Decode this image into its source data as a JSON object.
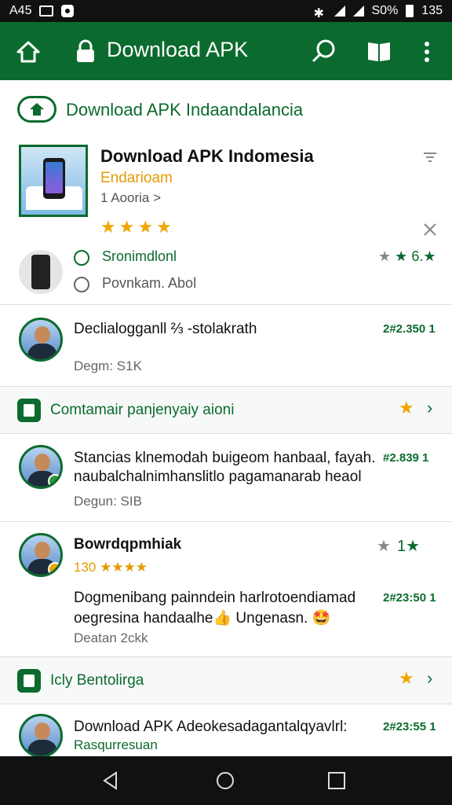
{
  "status_bar": {
    "left_text": "A45",
    "right_text": "S0%",
    "time": "135"
  },
  "app_bar": {
    "title": "Download APK",
    "icons": [
      "home-icon",
      "lock-icon",
      "search-icon",
      "book-icon",
      "more-vert-icon"
    ]
  },
  "header": {
    "title": "Download APK Indaandalancia"
  },
  "app": {
    "name": "Download APK Indomesia",
    "developer": "Endarioam",
    "meta": "1 Aooria >",
    "stars": "★★★★"
  },
  "options": [
    {
      "label": "Sronimdlonl",
      "selected": true
    },
    {
      "label": "Povnkam. Abol",
      "selected": false
    }
  ],
  "option_rating": {
    "value": "6.★",
    "stars_gray": "★",
    "stars_green": "★"
  },
  "rows": [
    {
      "title": "Declialogganll ⅔ -stolakrath",
      "sub": "Degm: S1K",
      "ts": "2#2.350 1"
    },
    {
      "title_line1": "Stancias klnemodah buigeom hanbaal, fayah.",
      "title_line2": "naubalchalnimhanslitlo pagamanarab heaol",
      "sub": "Degun: SIB",
      "ts": "#2.839 1"
    },
    {
      "title": "Bowrdqpmhiak",
      "rating": "130 ★★★★",
      "body_line1": "Dogmenibang painndein harlrotoendiamad",
      "body_line2": "oegresina handaalhe👍 Ungenasn. 🤩",
      "sub": "Deatan 2ckk",
      "ts": "2#23:50 1",
      "badge_stars": "1★"
    },
    {
      "title": "Download APK Adeokesadagantalqyavlrl:",
      "sub": "Rasqurresuan",
      "ts": "2#23:55 1"
    }
  ],
  "sections": [
    {
      "label": "Comtamair panjenyaiy aioni"
    },
    {
      "label": "Icly Bentolirga"
    }
  ]
}
